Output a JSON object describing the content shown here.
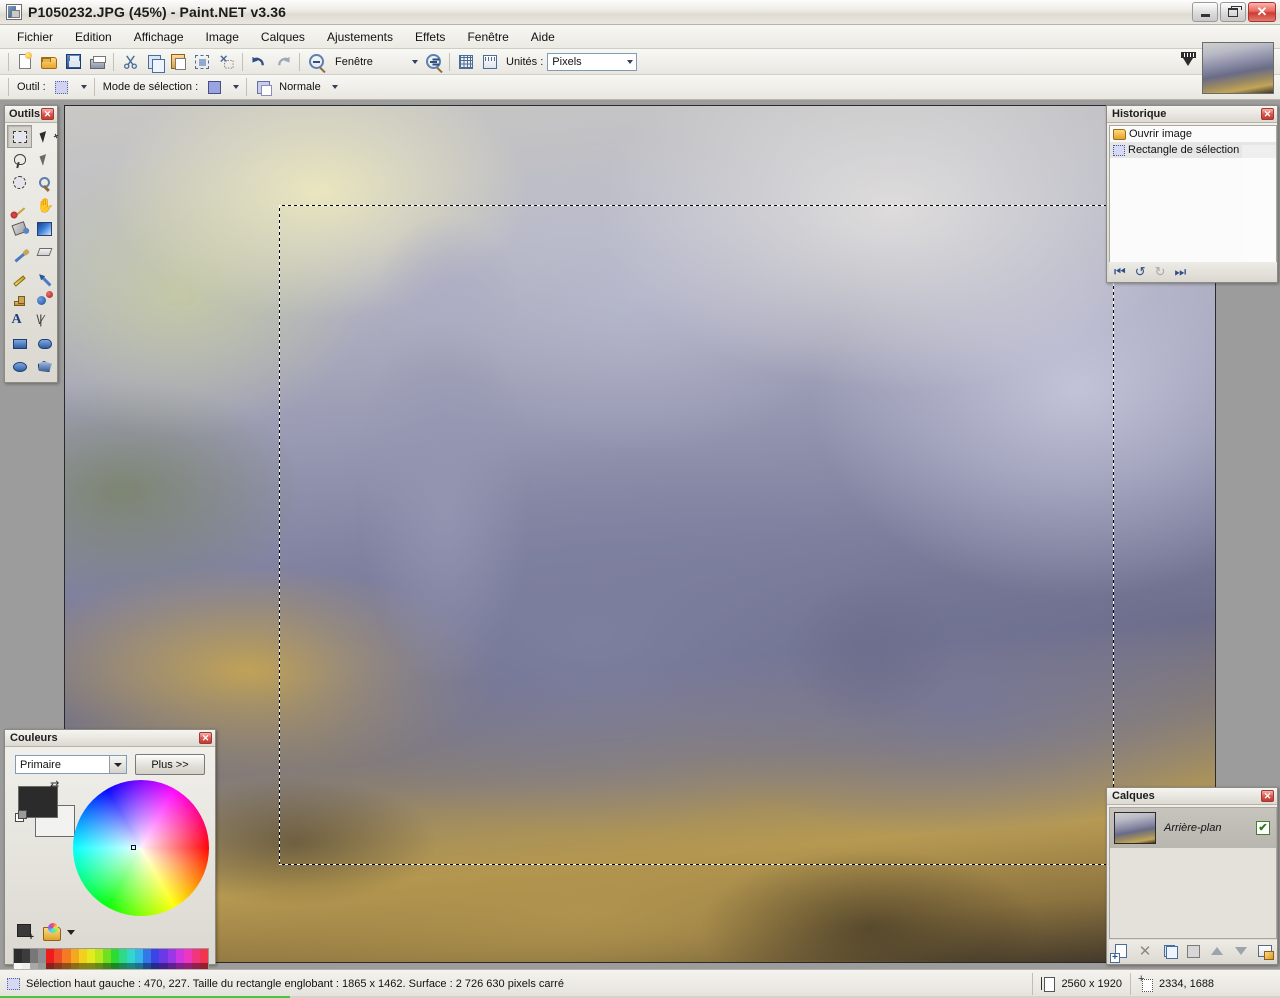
{
  "window": {
    "title": "P1050232.JPG (45%) - Paint.NET v3.36",
    "app_icon": "paintnet-icon",
    "minimize_label": "",
    "maximize_label": "",
    "close_label": "✕"
  },
  "menubar": {
    "items": [
      {
        "label": "Fichier",
        "accel": "F"
      },
      {
        "label": "Edition",
        "accel": "E"
      },
      {
        "label": "Affichage",
        "accel": "h"
      },
      {
        "label": "Image",
        "accel": "I"
      },
      {
        "label": "Calques",
        "accel": "C"
      },
      {
        "label": "Ajustements",
        "accel": "u"
      },
      {
        "label": "Effets",
        "accel": "t"
      },
      {
        "label": "Fenêtre",
        "accel": "n"
      },
      {
        "label": "Aide",
        "accel": "A"
      }
    ]
  },
  "toolbar": {
    "buttons": [
      {
        "name": "new-image-button",
        "icon": "new-page-icon",
        "tooltip": "Nouveau"
      },
      {
        "name": "open-image-button",
        "icon": "open-folder-icon",
        "tooltip": "Ouvrir"
      },
      {
        "name": "save-button",
        "icon": "save-disk-icon",
        "tooltip": "Enregistrer"
      },
      {
        "name": "print-button",
        "icon": "printer-icon",
        "tooltip": "Imprimer"
      },
      {
        "name": "cut-button",
        "icon": "scissors-icon",
        "tooltip": "Couper"
      },
      {
        "name": "copy-button",
        "icon": "copy-icon",
        "tooltip": "Copier"
      },
      {
        "name": "paste-button",
        "icon": "paste-icon",
        "tooltip": "Coller"
      },
      {
        "name": "crop-selection-button",
        "icon": "crop-icon",
        "tooltip": "Rogner"
      },
      {
        "name": "deselect-button",
        "icon": "deselect-icon",
        "tooltip": "Désélectionner"
      },
      {
        "name": "undo-button",
        "icon": "undo-arrow-icon",
        "tooltip": "Annuler"
      },
      {
        "name": "redo-button",
        "icon": "redo-arrow-icon",
        "tooltip": "Rétablir"
      }
    ],
    "zoom_out_icon": "zoom-out-icon",
    "zoom_in_icon": "zoom-in-icon",
    "zoom_value": "Fenêtre",
    "grid_icon": "grid-icon",
    "ruler_icon": "ruler-icon",
    "units_label": "Unités :",
    "units_value": "Pixels",
    "thumbnail_name": "image-thumbnail"
  },
  "toolbar2": {
    "tool_label": "Outil :",
    "tool_icon": "rectangle-select-icon",
    "selection_mode_label": "Mode de sélection :",
    "selection_mode_icon": "replace-selection-icon",
    "blend_label": "Normale",
    "blend_icon": "normal-blend-icon"
  },
  "tools_panel": {
    "title": "Outils",
    "close_label": "✕",
    "tools": [
      {
        "name": "rectangle-select-tool",
        "icon": "rectangle-select-icon",
        "active": true
      },
      {
        "name": "move-selected-tool",
        "icon": "move-selected-icon",
        "active": false
      },
      {
        "name": "lasso-select-tool",
        "icon": "lasso-select-icon",
        "active": false
      },
      {
        "name": "move-selection-tool",
        "icon": "move-selection-icon",
        "active": false
      },
      {
        "name": "ellipse-select-tool",
        "icon": "ellipse-select-icon",
        "active": false
      },
      {
        "name": "zoom-tool",
        "icon": "magnifier-icon",
        "active": false
      },
      {
        "name": "magic-wand-tool",
        "icon": "magic-wand-icon",
        "active": false
      },
      {
        "name": "pan-tool",
        "icon": "hand-icon",
        "active": false
      },
      {
        "name": "paint-bucket-tool",
        "icon": "paint-bucket-icon",
        "active": false
      },
      {
        "name": "gradient-tool",
        "icon": "gradient-icon",
        "active": false
      },
      {
        "name": "paintbrush-tool",
        "icon": "paintbrush-icon",
        "active": false
      },
      {
        "name": "eraser-tool",
        "icon": "eraser-icon",
        "active": false
      },
      {
        "name": "pencil-tool",
        "icon": "pencil-icon",
        "active": false
      },
      {
        "name": "color-picker-tool",
        "icon": "eyedropper-icon",
        "active": false
      },
      {
        "name": "clone-stamp-tool",
        "icon": "clone-stamp-icon",
        "active": false
      },
      {
        "name": "recolor-tool",
        "icon": "recolor-icon",
        "active": false
      },
      {
        "name": "text-tool",
        "icon": "text-a-icon",
        "active": false
      },
      {
        "name": "line-curve-tool",
        "icon": "line-curve-icon",
        "active": false
      },
      {
        "name": "rectangle-tool",
        "icon": "rectangle-shape-icon",
        "active": false
      },
      {
        "name": "rounded-rectangle-tool",
        "icon": "rounded-rectangle-icon",
        "active": false
      },
      {
        "name": "ellipse-tool",
        "icon": "ellipse-shape-icon",
        "active": false
      },
      {
        "name": "freeform-shape-tool",
        "icon": "freeform-shape-icon",
        "active": false
      }
    ]
  },
  "history_panel": {
    "title": "Historique",
    "close_label": "✕",
    "items": [
      {
        "label": "Ouvrir image",
        "icon": "open-folder-icon",
        "selected": false
      },
      {
        "label": "Rectangle de sélection",
        "icon": "rectangle-select-icon",
        "selected": true
      }
    ],
    "buttons": [
      {
        "name": "history-rewind-button",
        "glyph": "⏮",
        "enabled": true
      },
      {
        "name": "history-undo-button",
        "glyph": "↺",
        "enabled": true
      },
      {
        "name": "history-redo-button",
        "glyph": "↻",
        "enabled": false
      },
      {
        "name": "history-fastforward-button",
        "glyph": "⏭",
        "enabled": false
      }
    ]
  },
  "layers_panel": {
    "title": "Calques",
    "close_label": "✕",
    "rows": [
      {
        "name": "Arrière-plan",
        "visible": true,
        "check": "✔",
        "thumbnail": "layer-thumbnail"
      }
    ],
    "buttons": [
      {
        "name": "add-layer-button",
        "icon": "add-layer-icon"
      },
      {
        "name": "delete-layer-button",
        "icon": "delete-layer-icon"
      },
      {
        "name": "duplicate-layer-button",
        "icon": "duplicate-layer-icon"
      },
      {
        "name": "merge-layer-down-button",
        "icon": "merge-down-icon"
      },
      {
        "name": "move-layer-up-button",
        "icon": "arrow-up-icon"
      },
      {
        "name": "move-layer-down-button",
        "icon": "arrow-down-icon"
      },
      {
        "name": "layer-properties-button",
        "icon": "layer-properties-icon"
      }
    ]
  },
  "colors_panel": {
    "title": "Couleurs",
    "close_label": "✕",
    "mode_value": "Primaire",
    "more_label": "Plus >>",
    "primary_color": "#2b2b2b",
    "secondary_color": "#f2f2f0",
    "swap_icon": "swap-colors-icon",
    "reset_icon": "reset-colors-icon",
    "add-to-palette_icon": "add-to-palette-icon",
    "palette-menu_icon": "palette-menu-icon",
    "palette_top": [
      "#2d2d2d",
      "#3c3c3c",
      "#777777",
      "#8e8e8e",
      "#ef1c1c",
      "#f04a2a",
      "#f47b22",
      "#f3a81e",
      "#f2d01d",
      "#e4ea1c",
      "#b7e71d",
      "#6fe11e",
      "#2ddb35",
      "#2fd98a",
      "#32d7c9",
      "#33b6e8",
      "#3377e8",
      "#3b45e6",
      "#6b3ae6",
      "#9a38e5",
      "#cc37e2",
      "#ee36bf",
      "#f1357e",
      "#f2344c"
    ],
    "palette_bottom": [
      "#f7f7f7",
      "#ededed",
      "#a8a8a8",
      "#9a9a9a",
      "#8b2020",
      "#8e3a18",
      "#8f5116",
      "#8e6e14",
      "#8c8214",
      "#7f8b14",
      "#648c16",
      "#3d8a17",
      "#1b8821",
      "#1c8756",
      "#1d867e",
      "#1d7291",
      "#1d4a91",
      "#252a8f",
      "#431f90",
      "#60208f",
      "#80208e",
      "#931f77",
      "#94204f",
      "#951f30"
    ]
  },
  "canvas": {
    "image_name": "photo-canvas",
    "selection_name": "selection-marquee"
  },
  "statusbar": {
    "selection_icon": "rectangle-select-icon",
    "selection_text": "Sélection haut gauche : 470, 227. Taille du rectangle englobant : 1865 x 1462. Surface : 2 726 630 pixels carré",
    "image_size_icon": "image-size-icon",
    "image_size": "2560 x 1920",
    "cursor_icon": "cursor-position-icon",
    "cursor_position": "2334, 1688"
  }
}
